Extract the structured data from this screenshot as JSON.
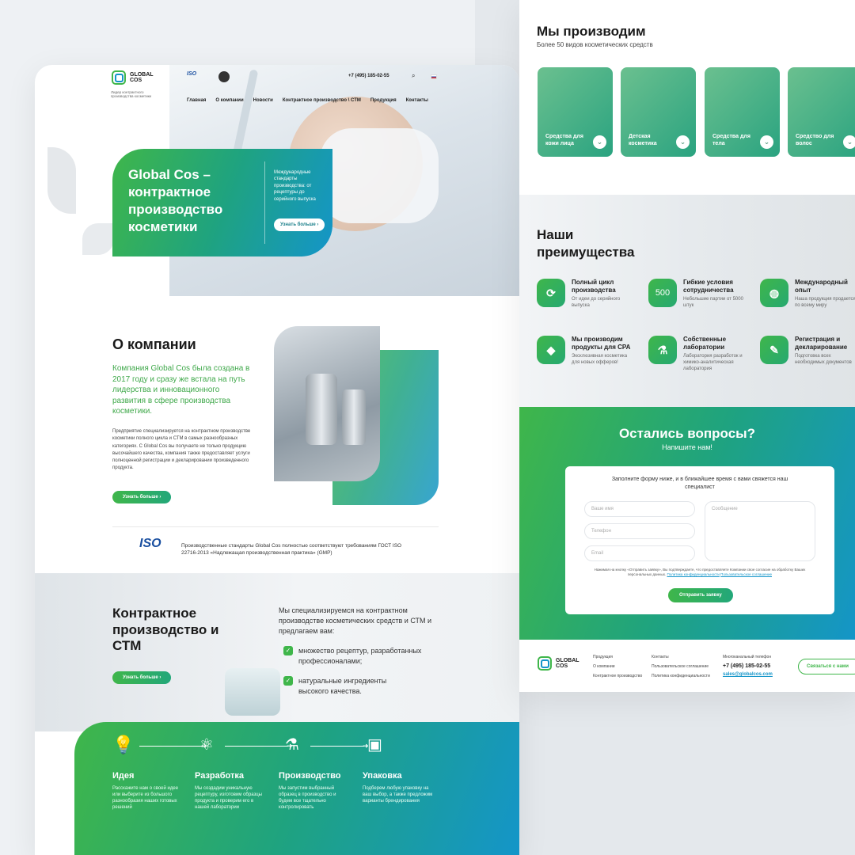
{
  "header": {
    "logo_line1": "GLOBAL",
    "logo_line2": "COS",
    "logo_tagline": "Лидер контрактного производства косметики",
    "iso_badge": "ISO",
    "phone": "+7 (495) 185-02-55",
    "nav": [
      "Главная",
      "О компании",
      "Новости",
      "Контрактное производство \\ СТМ",
      "Продукция",
      "Контакты"
    ]
  },
  "hero": {
    "title": "Global Cos – контрактное производство косметики",
    "subtitle": "Международные стандарты производства: от рецептуры до серийного выпуска",
    "button": "Узнать больше"
  },
  "about": {
    "title": "О компании",
    "lead": "Компания Global Cos была создана в 2017 году и сразу же встала на путь лидерства и инновационного развития в сфере производства косметики.",
    "body": "Предприятие специализируется на контрактном производстве косметики полного цикла и СТМ в самых разнообразных категориях. С Global Cos вы получаете не только продукцию высочайшего качества, компания также предоставляет услуги полноценной регистрации и декларировании произведенного продукта.",
    "button": "Узнать больше"
  },
  "iso": {
    "logo": "ISO",
    "text": "Производственные стандарты Global Cos полностью соответствуют требованиям ГОСТ ISO 22716-2013 «Надлежащая производственная практика» (GMP)"
  },
  "contract": {
    "title": "Контрактное производство и СТМ",
    "button": "Узнать больше",
    "intro": "Мы специализируемся на контрактном производстве косметических средств и СТМ и предлагаем вам:",
    "items": [
      "множество рецептур, разработанных профессионалами;",
      "натуральные ингредиенты высокого качества."
    ]
  },
  "steps": [
    {
      "title": "Идея",
      "desc": "Расскажите нам о своей идее или выберите из большого разнообразия наших готовых решений"
    },
    {
      "title": "Разработка",
      "desc": "Мы создадим уникальную рецептуру, изготовим образцы продукта и проверим его в нашей лаборатории"
    },
    {
      "title": "Производство",
      "desc": "Мы запустим выбранный образец в производство и будем все тщательно контролировать"
    },
    {
      "title": "Упаковка",
      "desc": "Подберем любую упаковку на ваш выбор, а также предложим варианты брендирования"
    }
  ],
  "produce": {
    "title": "Мы производим",
    "subtitle": "Более 50 видов косметических средств",
    "categories": [
      "Средства для кожи лица",
      "Детская косметика",
      "Средства для тела",
      "Средство для волос"
    ]
  },
  "advantages": {
    "title": "Наши преимущества",
    "items": [
      {
        "title": "Полный цикл производства",
        "desc": "От идеи до серийного выпуска"
      },
      {
        "title": "Гибкие условия сотрудничества",
        "desc": "Небольшие партии от 5000 штук",
        "badge": "500"
      },
      {
        "title": "Международный опыт",
        "desc": "Наша продукция продается по всему миру"
      },
      {
        "title": "Мы производим продукты для СРА",
        "desc": "Эксклюзивная косметика для новых офферов!"
      },
      {
        "title": "Собственные лаборатории",
        "desc": "Лаборатория разработок и химико-аналитическая лаборатория"
      },
      {
        "title": "Регистрация и декларирование",
        "desc": "Подготовка всех необходимых документов"
      }
    ]
  },
  "contact_form": {
    "title": "Остались вопросы?",
    "subtitle": "Напишите нам!",
    "intro": "Заполните форму ниже, и в ближайшее время с вами свяжется наш специалист",
    "name_placeholder": "Ваше имя",
    "phone_placeholder": "Телефон",
    "email_placeholder": "Email",
    "message_placeholder": "Сообщение",
    "consent": "Нажимая на кнопку «Отправить заявку», Вы подтверждаете, что предоставляете Компании свое согласие на обработку Ваших персональных данных.",
    "privacy_link": "Политика конфиденциальности",
    "terms_link": "Пользовательское соглашение",
    "submit": "Отправить заявку"
  },
  "footer": {
    "col1": [
      "Продукция",
      "О компании",
      "Контрактное производство"
    ],
    "col2": [
      "Контакты",
      "Пользовательское соглашение",
      "Политика конфиденциальности"
    ],
    "phone_label": "Многоканальный телефон",
    "phone": "+7 (495) 185-02-55",
    "email": "sales@globalcos.com",
    "contact_button": "Связаться с нами"
  },
  "colors": {
    "green": "#3fb64a",
    "teal": "#1fa37f",
    "blue": "#1495c9"
  }
}
